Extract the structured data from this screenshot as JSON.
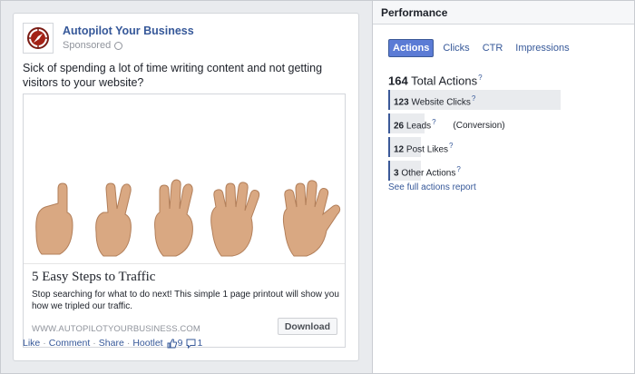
{
  "post": {
    "page_name": "Autopilot Your Business",
    "sponsored_label": "Sponsored",
    "text": "Sick of spending a lot of time writing content and not getting visitors to your website?",
    "link": {
      "title": "5 Easy Steps to Traffic",
      "description": "Stop searching for what to do next! This simple 1 page printout will show you how we tripled our traffic.",
      "domain": "WWW.AUTOPILOTYOURBUSINESS.COM",
      "cta_label": "Download"
    },
    "actions": {
      "like": "Like",
      "comment": "Comment",
      "share": "Share",
      "hootlet": "Hootlet",
      "like_count": "9",
      "comment_count": "1"
    }
  },
  "performance": {
    "title": "Performance",
    "tabs": [
      {
        "label": "Actions",
        "active": true
      },
      {
        "label": "Clicks",
        "active": false
      },
      {
        "label": "CTR",
        "active": false
      },
      {
        "label": "Impressions",
        "active": false
      }
    ],
    "total": {
      "count": "164",
      "label": "Total Actions"
    },
    "actions": [
      {
        "count": "123",
        "label": "Website Clicks",
        "extra": "",
        "fraction": 1.0
      },
      {
        "count": "26",
        "label": "Leads",
        "extra": "(Conversion)",
        "fraction": 0.21
      },
      {
        "count": "12",
        "label": "Post Likes",
        "extra": "",
        "fraction": 0.1
      },
      {
        "count": "3",
        "label": "Other Actions",
        "extra": "",
        "fraction": 0.025
      }
    ],
    "full_report_link": "See full actions report"
  },
  "colors": {
    "link_blue": "#365899",
    "active_tab": "#5b7bd5",
    "bar_bg": "#e9ebee",
    "bar_accent": "#3b5998"
  }
}
